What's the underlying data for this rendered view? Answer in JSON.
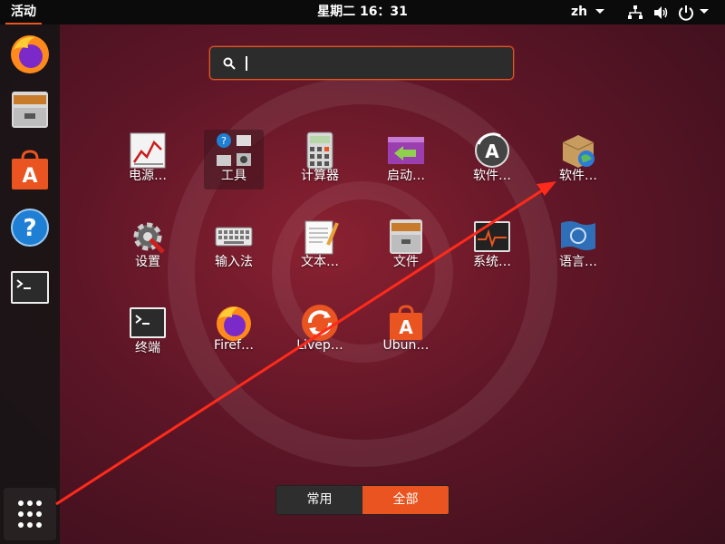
{
  "topbar": {
    "activities": "活动",
    "clock": "星期二 16：31",
    "lang": "zh"
  },
  "dock": {
    "icons": [
      "firefox-icon",
      "files-icon",
      "software-store-icon",
      "help-icon",
      "terminal-icon"
    ],
    "show_apps": "show-applications-icon"
  },
  "search": {
    "value": "",
    "placeholder": ""
  },
  "apps": [
    {
      "label": "电源…"
    },
    {
      "label": "工具"
    },
    {
      "label": "计算器"
    },
    {
      "label": "启动…"
    },
    {
      "label": "软件…"
    },
    {
      "label": "软件…"
    },
    {
      "label": "设置"
    },
    {
      "label": "输入法"
    },
    {
      "label": "文本…"
    },
    {
      "label": "文件"
    },
    {
      "label": "系统…"
    },
    {
      "label": "语言…"
    },
    {
      "label": "终端"
    },
    {
      "label": "Firef…"
    },
    {
      "label": "Livep…"
    },
    {
      "label": "Ubun…"
    }
  ],
  "tabs": {
    "frequent": "常用",
    "all": "全部"
  },
  "colors": {
    "accent": "#e95420",
    "annotation": "#ff2a1a"
  }
}
